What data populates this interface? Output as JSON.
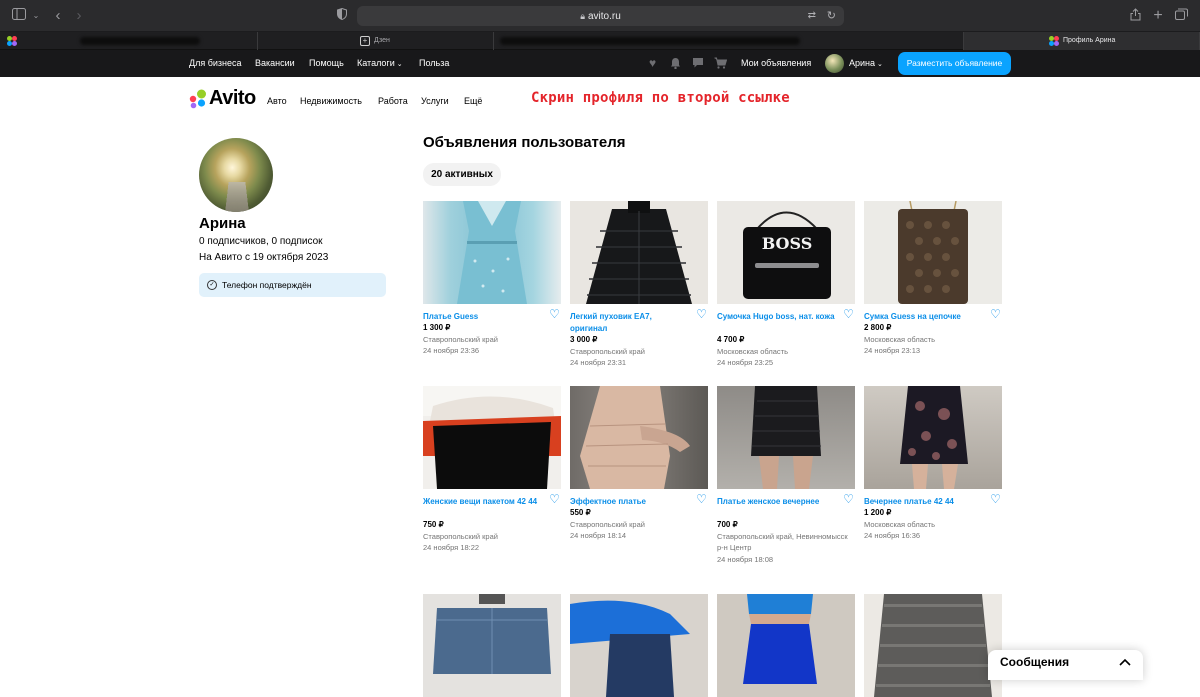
{
  "browser": {
    "address": "avito.ru",
    "tabs": [
      {
        "label": ""
      },
      {
        "label": "Дзен"
      },
      {
        "label": ""
      },
      {
        "label": "Профиль Арина"
      }
    ]
  },
  "header": {
    "nav_items": [
      "Для бизнеса",
      "Вакансии",
      "Помощь",
      "Каталоги",
      "Польза"
    ],
    "my_ads": "Мои объявления",
    "user_name": "Арина",
    "post_button": "Разместить объявление"
  },
  "subheader": {
    "logo_text": "Avito",
    "categories": [
      "Авто",
      "Недвижимость",
      "Работа",
      "Услуги",
      "Ещё"
    ],
    "annotation": "Скрин профиля по второй ссылке"
  },
  "profile": {
    "name": "Арина",
    "followers": "0 подписчиков, 0 подписок",
    "since": "На Авито с 19 октября 2023",
    "phone_verified": "Телефон подтверждён"
  },
  "listings": {
    "title": "Объявления пользователя",
    "active_count": "20 активных",
    "items": [
      {
        "title": "Платье Guess",
        "price": "1 300 ₽",
        "location": "Ставропольский край",
        "date": "24 ноября 23:36"
      },
      {
        "title": "Легкий пуховик EA7, оригинал",
        "price": "3 000 ₽",
        "location": "Ставропольский край",
        "date": "24 ноября 23:31"
      },
      {
        "title": "Сумочка Hugo boss, нат. кожа",
        "price": "4 700 ₽",
        "location": "Московская область",
        "date": "24 ноября 23:25",
        "brand_print": "BOSS"
      },
      {
        "title": "Сумка Guess на цепочке",
        "price": "2 800 ₽",
        "location": "Московская область",
        "date": "24 ноября 23:13"
      },
      {
        "title": "Женские вещи пакетом 42 44",
        "price": "750 ₽",
        "location": "Ставропольский край",
        "date": "24 ноября 18:22"
      },
      {
        "title": "Эффектное платье",
        "price": "550 ₽",
        "location": "Ставропольский край",
        "date": "24 ноября 18:14"
      },
      {
        "title": "Платье женское вечернее",
        "price": "700 ₽",
        "location": "Ставропольский край, Невинномысск",
        "location2": "р-н Центр",
        "date": "24 ноября 18:08"
      },
      {
        "title": "Вечернее платье 42 44",
        "price": "1 200 ₽",
        "location": "Московская область",
        "date": "24 ноября 16:36"
      }
    ]
  },
  "messages": {
    "label": "Сообщения"
  },
  "colors": {
    "accent": "#0aa3ff",
    "link": "#0a8ee8",
    "annotation": "#e4252b"
  }
}
